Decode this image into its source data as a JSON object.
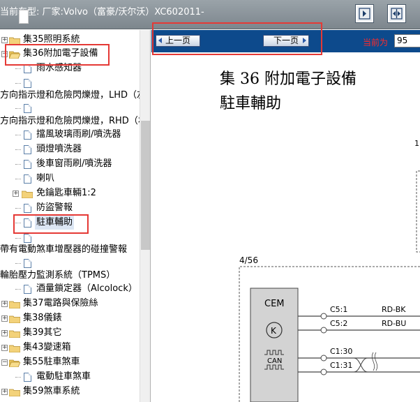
{
  "header": {
    "car_type": "当前车型:  厂家:Volvo（富豪/沃尔沃）XC602011-"
  },
  "tree": {
    "items": [
      {
        "label": "集35照明系統",
        "kind": "folder"
      },
      {
        "label": "集36附加電子設備",
        "kind": "folder-open"
      },
      {
        "label": "雨水感知器",
        "kind": "doc"
      },
      {
        "label": "",
        "kind": "doc"
      },
      {
        "label": "方向指示燈和危險閃爍燈，LHD（左",
        "kind": "text"
      },
      {
        "label": "",
        "kind": "doc"
      },
      {
        "label": "方向指示燈和危險閃爍燈，RHD（右",
        "kind": "text"
      },
      {
        "label": "擋風玻璃雨刷/噴洗器",
        "kind": "doc"
      },
      {
        "label": "頭燈噴洗器",
        "kind": "doc"
      },
      {
        "label": "後車窗雨刷/噴洗器",
        "kind": "doc"
      },
      {
        "label": "喇叭",
        "kind": "doc"
      },
      {
        "label": "免鑰匙車輛1:2",
        "kind": "folder"
      },
      {
        "label": "防盜警報",
        "kind": "doc"
      },
      {
        "label": "駐車輔助",
        "kind": "doc"
      },
      {
        "label": "",
        "kind": "doc"
      },
      {
        "label": "帶有電動煞車增壓器的碰撞警報",
        "kind": "text"
      },
      {
        "label": "",
        "kind": "doc"
      },
      {
        "label": "輪胎壓力監測系統（TPMS）",
        "kind": "text"
      },
      {
        "label": "酒量鎖定器（Alcolock）",
        "kind": "doc"
      },
      {
        "label": "集37電路與保險絲",
        "kind": "folder"
      },
      {
        "label": "集38儀錶",
        "kind": "folder"
      },
      {
        "label": "集39其它",
        "kind": "folder"
      },
      {
        "label": "集43變速箱",
        "kind": "folder"
      },
      {
        "label": "集55駐車煞車",
        "kind": "folder"
      },
      {
        "label": "電動駐車煞車",
        "kind": "doc"
      },
      {
        "label": "集59煞車系統",
        "kind": "folder"
      }
    ]
  },
  "nav": {
    "prev_label": "上一页",
    "next_label": "下一页",
    "current_label": "当前为",
    "page_value": "95"
  },
  "document": {
    "title": "集 36 附加電子設備",
    "subtitle": "駐車輔助",
    "corner_label": "1",
    "module_ref": "4/56",
    "module_name": "CEM",
    "module_bus": "CAN",
    "pins": [
      {
        "pin": "C5:1",
        "wire": "RD-BK"
      },
      {
        "pin": "C5:2",
        "wire": "RD-BU"
      },
      {
        "pin": "C1:30",
        "wire": ""
      },
      {
        "pin": "C1:31",
        "wire": ""
      }
    ]
  },
  "colors": {
    "nav_bar": "#0d4a8c",
    "highlight": "#e53935",
    "current_label": "#ff2a2a"
  }
}
